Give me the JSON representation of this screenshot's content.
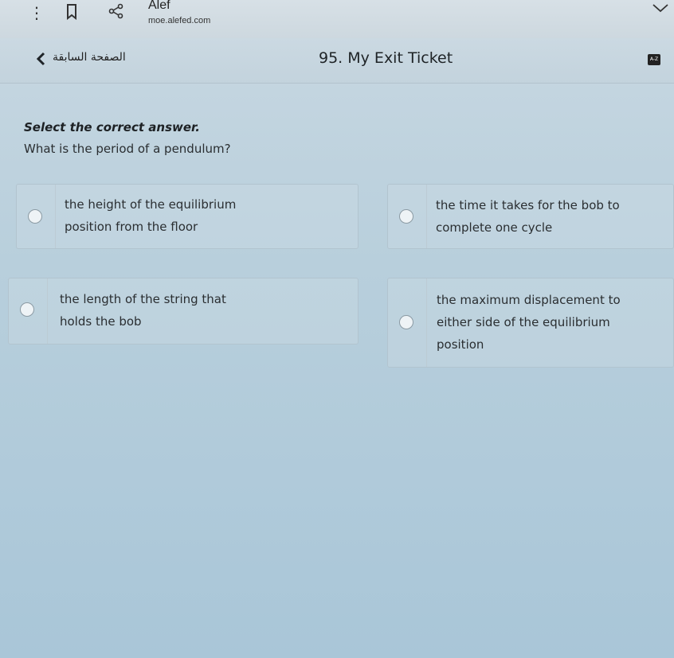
{
  "browser": {
    "app_title": "Alef",
    "url": "moe.alefed.com"
  },
  "header": {
    "back_label": "الصفحة السابقة",
    "title": "95. My Exit Ticket",
    "badge_text": "A-Z"
  },
  "quiz": {
    "instruction": "Select the correct answer.",
    "question": "What is the period of a pendulum?",
    "options": [
      {
        "line1": "the height of the equilibrium",
        "line2": "position from the floor"
      },
      {
        "line1": "the time it takes for the bob to",
        "line2": "complete one cycle"
      },
      {
        "line1": "the length of the string that",
        "line2": "holds the bob"
      },
      {
        "line1": "the maximum displacement to",
        "line2": "either side of the equilibrium",
        "line3": "position"
      }
    ]
  },
  "icons": [
    "more-vertical-icon",
    "bookmark-icon",
    "share-icon",
    "chevron-down-icon",
    "chevron-left-icon",
    "dictionary-icon"
  ]
}
